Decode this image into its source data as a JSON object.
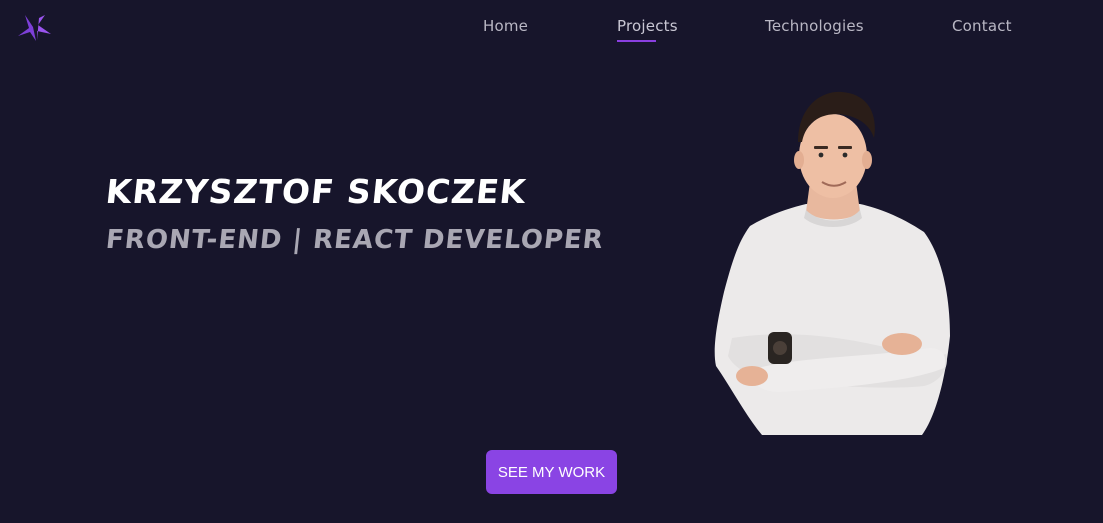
{
  "logo": {
    "icon": "ks-monogram-icon",
    "color": "#8a3fe0"
  },
  "nav": {
    "items": [
      {
        "label": "Home"
      },
      {
        "label": "Projects",
        "active": true
      },
      {
        "label": "Technologies"
      },
      {
        "label": "Contact"
      }
    ],
    "active_color": "#8a3fe0"
  },
  "hero": {
    "name": "KRZYSZTOF SKOCZEK",
    "role": "FRONT-END | REACT DEVELOPER",
    "cta_label": "SEE MY WORK",
    "photo": "portrait-photo"
  },
  "colors": {
    "background": "#17152b",
    "accent": "#8a44e4"
  }
}
